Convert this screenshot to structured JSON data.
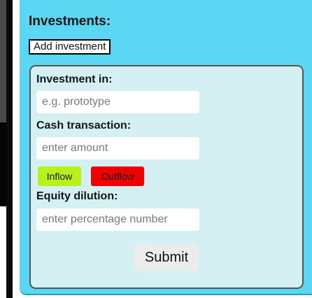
{
  "investments": {
    "title": "Investments:",
    "add_button_label": "Add investment"
  },
  "form": {
    "investment_in_label": "Investment in:",
    "investment_in_placeholder": "e.g. prototype",
    "cash_label": "Cash transaction:",
    "cash_placeholder": "enter amount",
    "inflow_label": "Inflow",
    "outflow_label": "Outflow",
    "equity_label": "Equity dilution:",
    "equity_placeholder": "enter percentage number",
    "submit_label": "Submit"
  },
  "colors": {
    "panel_background": "#5bd6f3",
    "card_background": "#d4f0f3",
    "inflow": "#b7f21c",
    "outflow": "#f00000"
  }
}
